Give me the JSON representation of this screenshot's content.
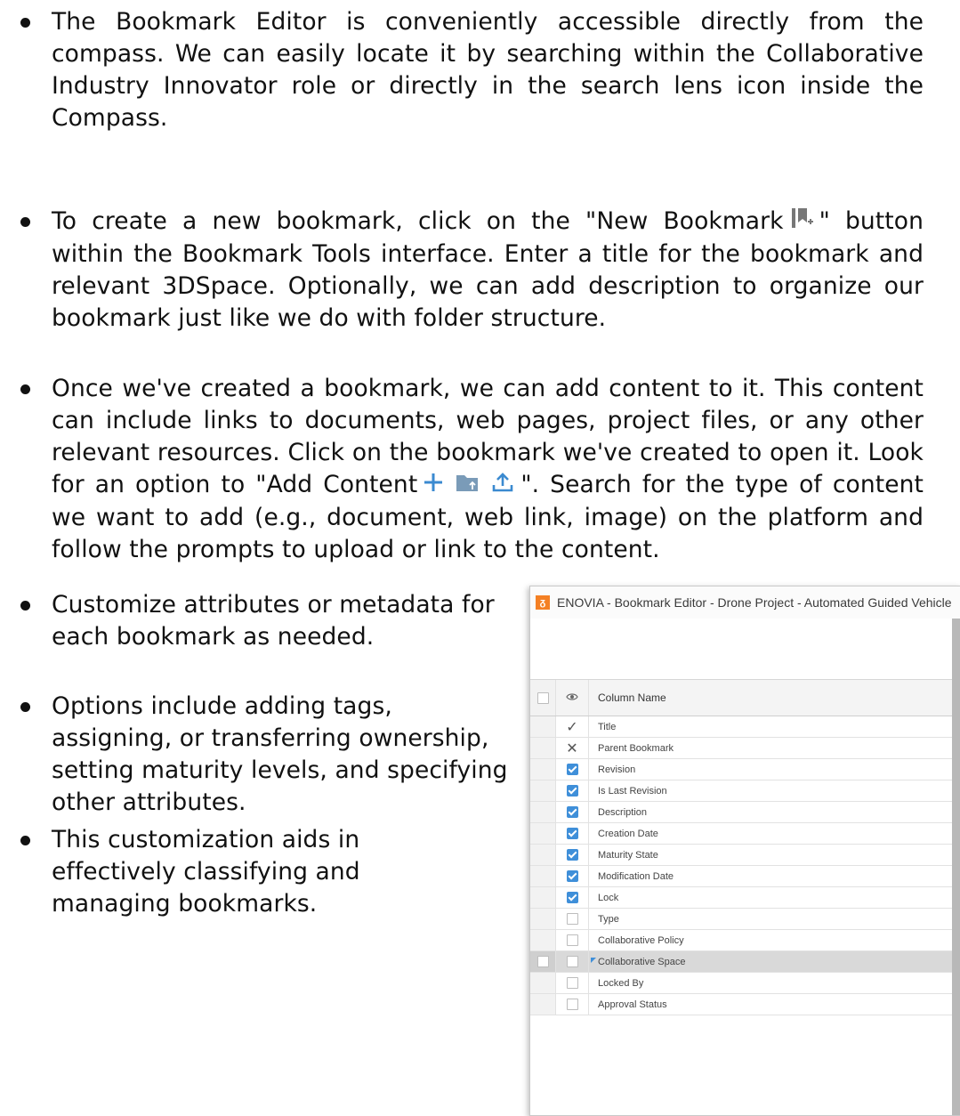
{
  "bullets": [
    "The Bookmark Editor is conveniently accessible directly from the compass. We can easily locate it by searching within the Collaborative Industry Innovator role or directly in the search lens icon inside the Compass.",
    {
      "before": "To create a new bookmark, click on the \"New Bookmark",
      "after": "\" button within the Bookmark Tools interface. Enter a title for the bookmark and relevant 3DSpace. Optionally, we can add description to organize our bookmark just like we do with folder structure."
    },
    {
      "before": "Once we've created a bookmark, we can add content to it. This content can include links to documents, web pages, project files, or any other relevant resources. Click on the bookmark we've created to open it. Look for an option to \"Add Content",
      "after": "\". Search for the type of content we want to add (e.g., document, web link, image) on the platform and follow the prompts to upload or link to the content."
    },
    "Customize attributes or metadata for each bookmark as needed.",
    "Options include adding tags, assigning, or transferring ownership, setting maturity levels, and specifying other attributes.",
    "This customization aids in effectively classifying and managing bookmarks."
  ],
  "icons": {
    "new_bookmark": "new-bookmark-icon",
    "add": "plus-icon",
    "add_folder": "folder-add-icon",
    "upload": "upload-icon",
    "visibility": "eye-icon",
    "app_logo": "3ds-logo-icon"
  },
  "screenshot": {
    "title": "ENOVIA - Bookmark Editor - Drone Project - Automated Guided Vehicle",
    "column_header": "Column Name",
    "rows": [
      {
        "name": "Title",
        "state": "check"
      },
      {
        "name": "Parent Bookmark",
        "state": "cross"
      },
      {
        "name": "Revision",
        "state": "checked"
      },
      {
        "name": "Is Last Revision",
        "state": "checked"
      },
      {
        "name": "Description",
        "state": "checked"
      },
      {
        "name": "Creation Date",
        "state": "checked"
      },
      {
        "name": "Maturity State",
        "state": "checked"
      },
      {
        "name": "Modification Date",
        "state": "checked"
      },
      {
        "name": "Lock",
        "state": "checked"
      },
      {
        "name": "Type",
        "state": "unchecked"
      },
      {
        "name": "Collaborative Policy",
        "state": "unchecked"
      },
      {
        "name": "Collaborative Space",
        "state": "unchecked",
        "selected": true
      },
      {
        "name": "Locked By",
        "state": "unchecked"
      },
      {
        "name": "Approval Status",
        "state": "unchecked"
      }
    ],
    "accent_color": "#3f8fd9"
  }
}
